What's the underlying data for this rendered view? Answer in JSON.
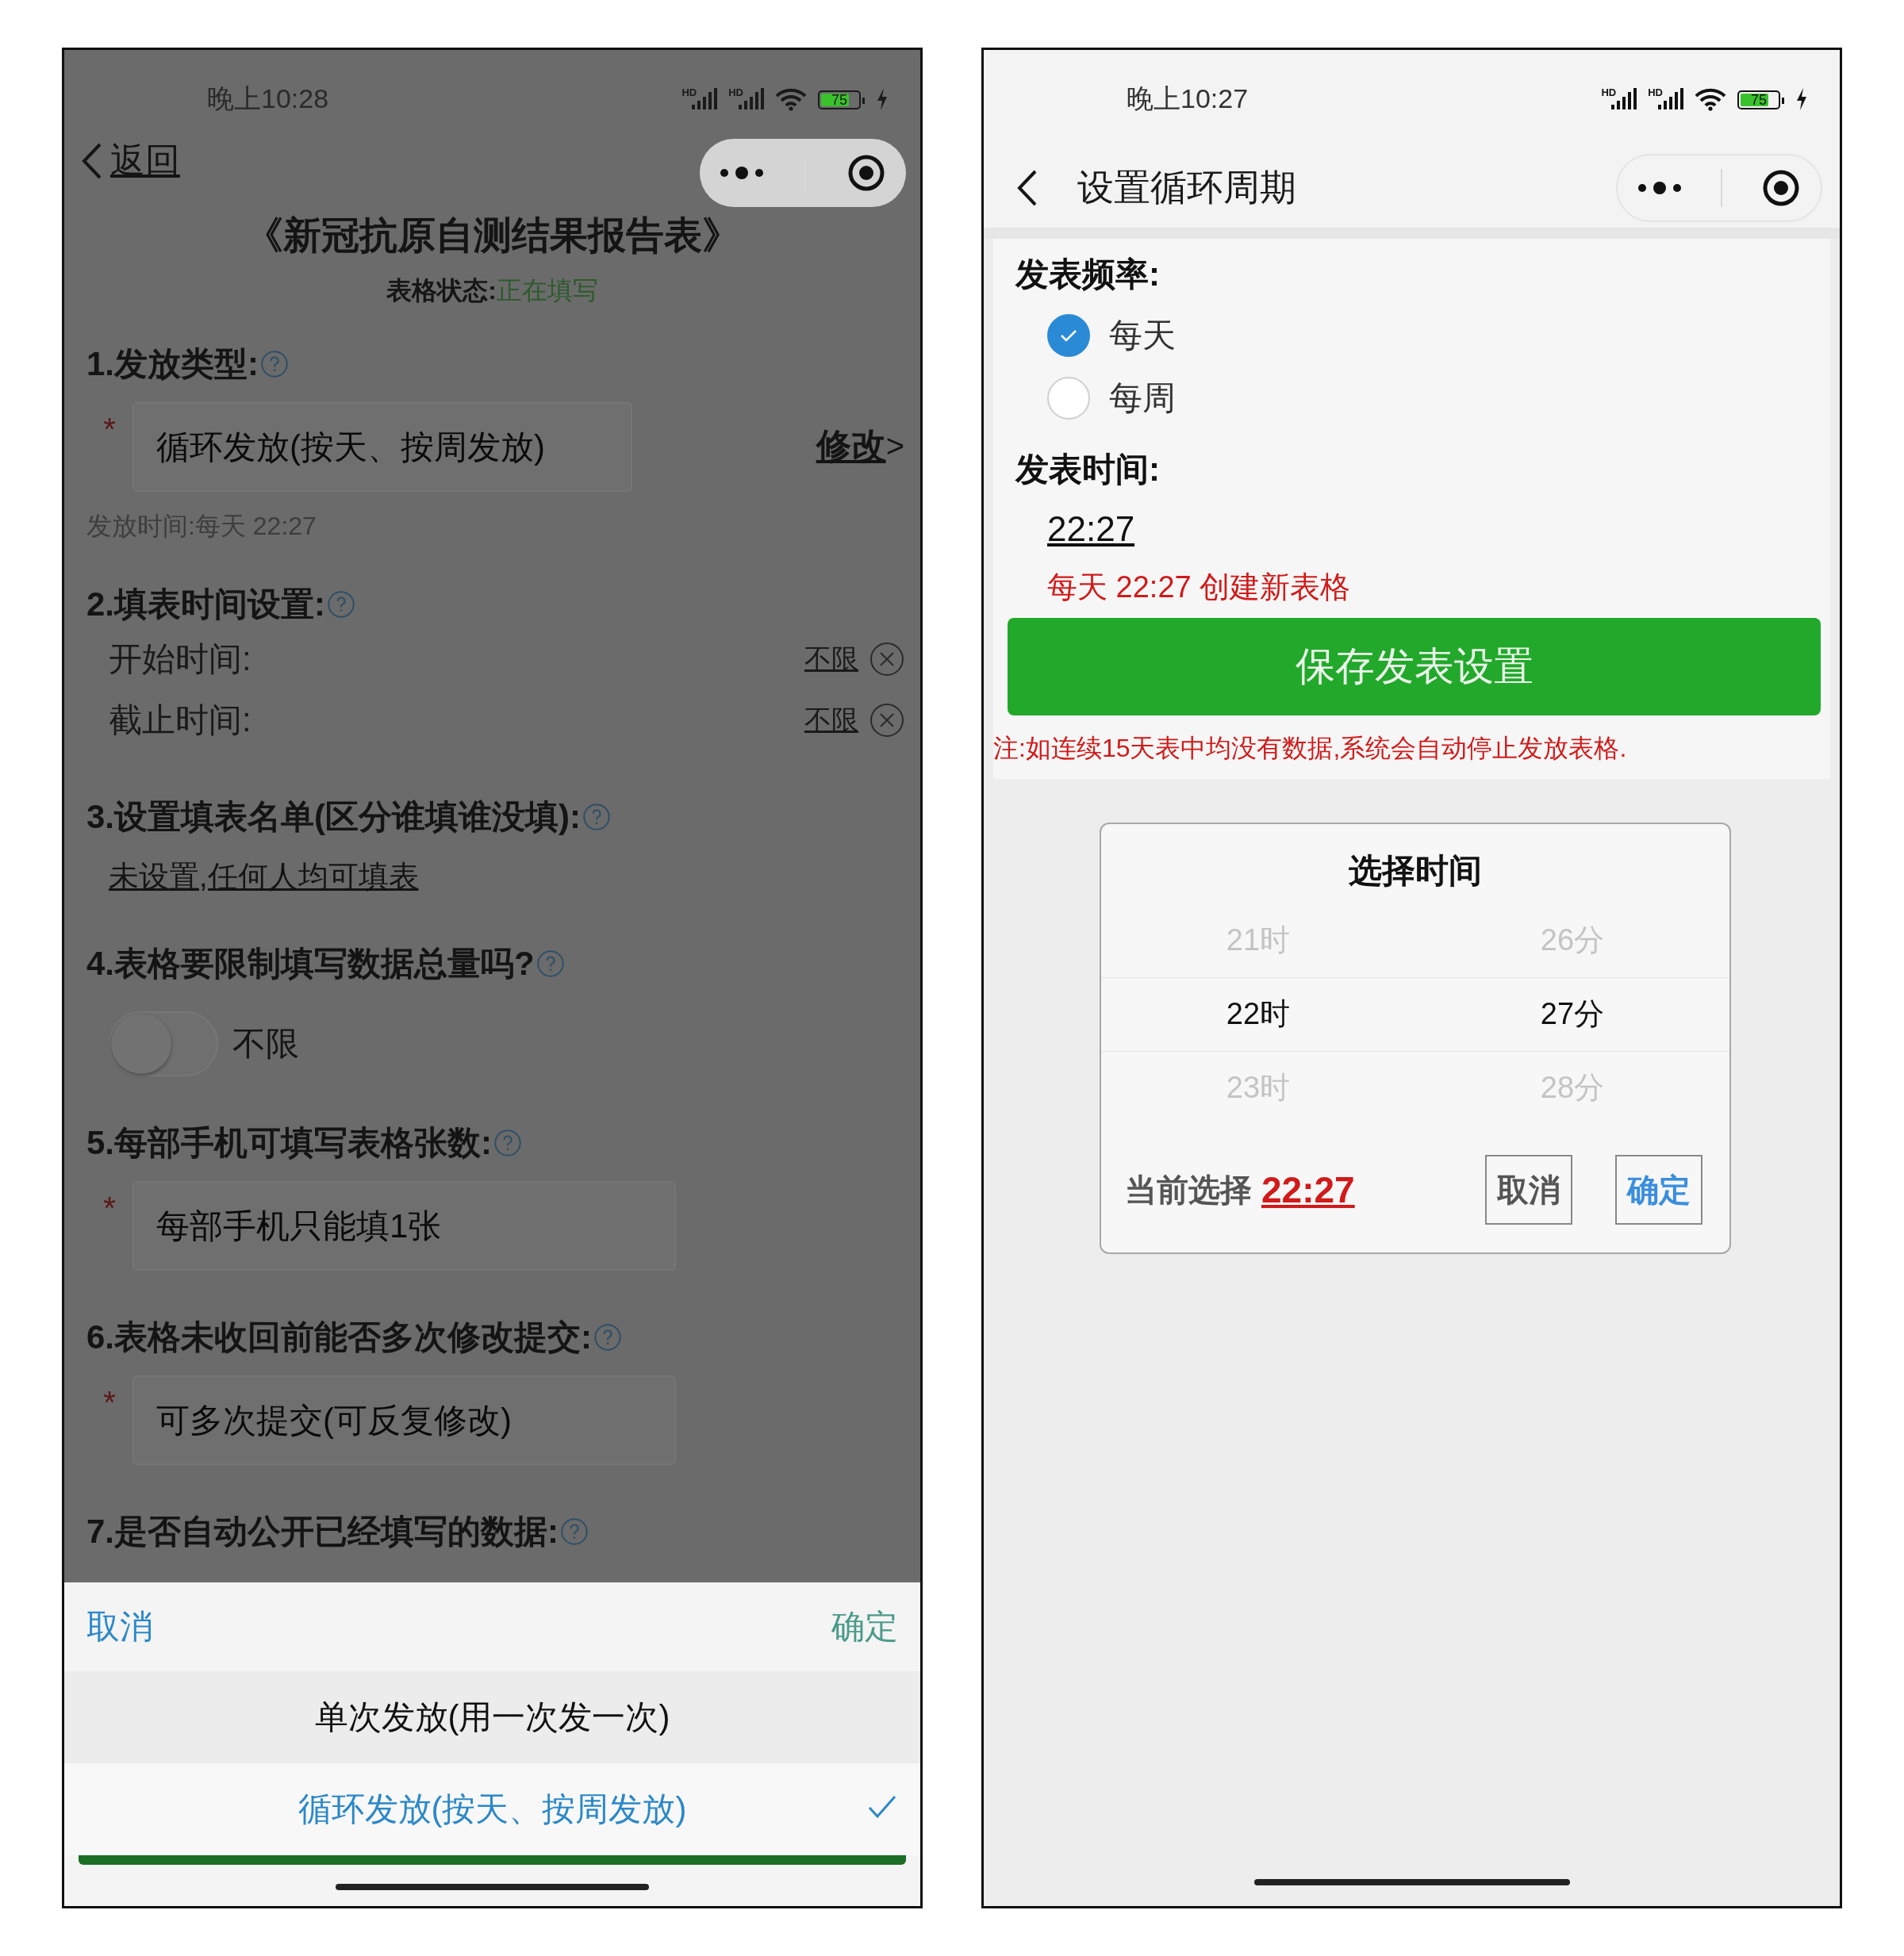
{
  "left_screen": {
    "status_bar": {
      "time": "晚上10:28",
      "signal_labels": [
        "HD",
        "HD"
      ],
      "battery": "75"
    },
    "nav": {
      "back_label": "返回"
    },
    "form_title": "《新冠抗原自测结果报告表》",
    "form_status": {
      "label": "表格状态:",
      "value": "正在填写"
    },
    "sections": [
      {
        "kind": "select",
        "heading": "1.发放类型:",
        "marker": "*",
        "value": "循环发放(按天、按周发放)",
        "action": "修改",
        "action_arrow": ">",
        "note": "发放时间:每天 22:27"
      },
      {
        "kind": "time_range",
        "heading": "2.填表时间设置:",
        "rows": [
          {
            "label": "开始时间:",
            "value": "不限"
          },
          {
            "label": "截止时间:",
            "value": "不限"
          }
        ]
      },
      {
        "kind": "link",
        "heading": "3.设置填表名单(区分谁填谁没填):",
        "link": "未设置,任何人均可填表"
      },
      {
        "kind": "toggle",
        "heading": "4.表格要限制填写数据总量吗?",
        "on": false,
        "label": "不限"
      },
      {
        "kind": "select",
        "heading": "5.每部手机可填写表格张数:",
        "marker": "*",
        "value": "每部手机只能填1张"
      },
      {
        "kind": "select",
        "heading": "6.表格未收回前能否多次修改提交:",
        "marker": "*",
        "value": "可多次提交(可反复修改)"
      },
      {
        "kind": "heading",
        "heading": "7.是否自动公开已经填写的数据:"
      }
    ],
    "bottom_sheet": {
      "cancel": "取消",
      "confirm": "确定",
      "options": [
        {
          "label": "单次发放(用一次发一次)",
          "selected": false
        },
        {
          "label": "循环发放(按天、按周发放)",
          "selected": true
        }
      ]
    }
  },
  "right_screen": {
    "status_bar": {
      "time": "晚上10:27",
      "signal_labels": [
        "HD",
        "HD"
      ],
      "battery": "75"
    },
    "nav": {
      "title": "设置循环周期"
    },
    "frequency": {
      "label": "发表频率:",
      "options": [
        {
          "label": "每天",
          "selected": true
        },
        {
          "label": "每周",
          "selected": false
        }
      ]
    },
    "publish_time": {
      "label": "发表时间:",
      "value": "22:27",
      "summary": "每天 22:27 创建新表格"
    },
    "save_button": "保存发表设置",
    "note": "注:如连续15天表中均没有数据,系统会自动停止发放表格.",
    "time_picker": {
      "title": "选择时间",
      "columns": [
        {
          "items": [
            {
              "label": "21时",
              "selected": false
            },
            {
              "label": "22时",
              "selected": true
            },
            {
              "label": "23时",
              "selected": false
            }
          ]
        },
        {
          "items": [
            {
              "label": "26分",
              "selected": false
            },
            {
              "label": "27分",
              "selected": true
            },
            {
              "label": "28分",
              "selected": false
            }
          ]
        }
      ],
      "current_label": "当前选择",
      "current_value": "22:27",
      "cancel": "取消",
      "confirm": "确定"
    }
  }
}
